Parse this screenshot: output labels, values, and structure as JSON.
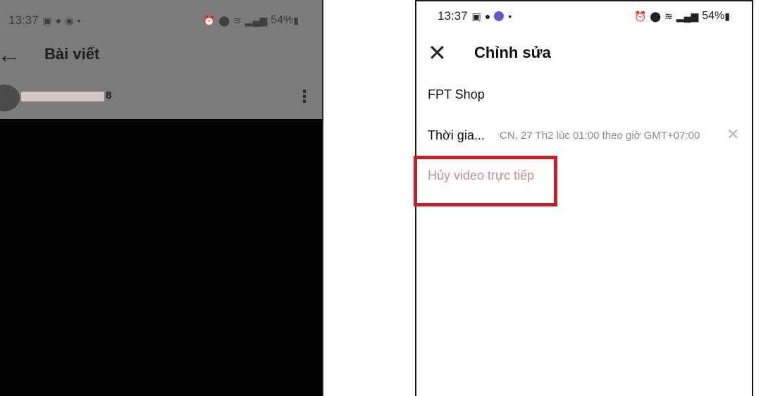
{
  "status_bar": {
    "time": "13:37",
    "battery": "54%",
    "icons": [
      "gallery-icon",
      "facebook-icon",
      "messenger-icon",
      "alarm-icon",
      "location-icon",
      "wifi-icon",
      "signal-icon",
      "battery-icon"
    ]
  },
  "left_screen": {
    "header_title": "Bài viết",
    "post_author_tail": "8",
    "icons": {
      "back": "back-arrow-icon",
      "more": "more-vertical-icon"
    }
  },
  "right_screen": {
    "header_title": "Chỉnh sửa",
    "page_name": "FPT Shop",
    "schedule_label": "Thời gia...",
    "schedule_value": "CN, 27 Th2 lúc 01:00 theo giờ GMT+07:00",
    "cancel_live_label": "Hủy video trực tiếp",
    "icons": {
      "close": "close-icon",
      "clear": "clear-icon"
    }
  },
  "colors": {
    "highlight": "#c81d2b",
    "dimmed_overlay": "#7b7b7b",
    "cancel_text": "#c98e8e",
    "muted_text": "#8a8a8a"
  }
}
